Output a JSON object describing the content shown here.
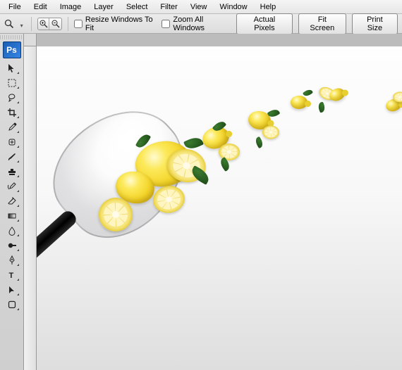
{
  "menu": [
    "File",
    "Edit",
    "Image",
    "Layer",
    "Select",
    "Filter",
    "View",
    "Window",
    "Help"
  ],
  "opt": {
    "resize_label": "Resize Windows To Fit",
    "zoom_all_label": "Zoom All Windows",
    "actual": "Actual Pixels",
    "fit": "Fit Screen",
    "print": "Print Size"
  },
  "ruler": {
    "start": 600,
    "step": 100,
    "count": 11
  },
  "ps_logo": "Ps",
  "tools": [
    "move-tool",
    "marquee-tool",
    "lasso-tool",
    "crop-tool",
    "eyedropper-tool",
    "healing-brush-tool",
    "brush-tool",
    "clone-stamp-tool",
    "history-brush-tool",
    "eraser-tool",
    "gradient-tool",
    "blur-tool",
    "dodge-tool",
    "pen-tool",
    "type-tool",
    "path-selection-tool",
    "shape-tool"
  ]
}
